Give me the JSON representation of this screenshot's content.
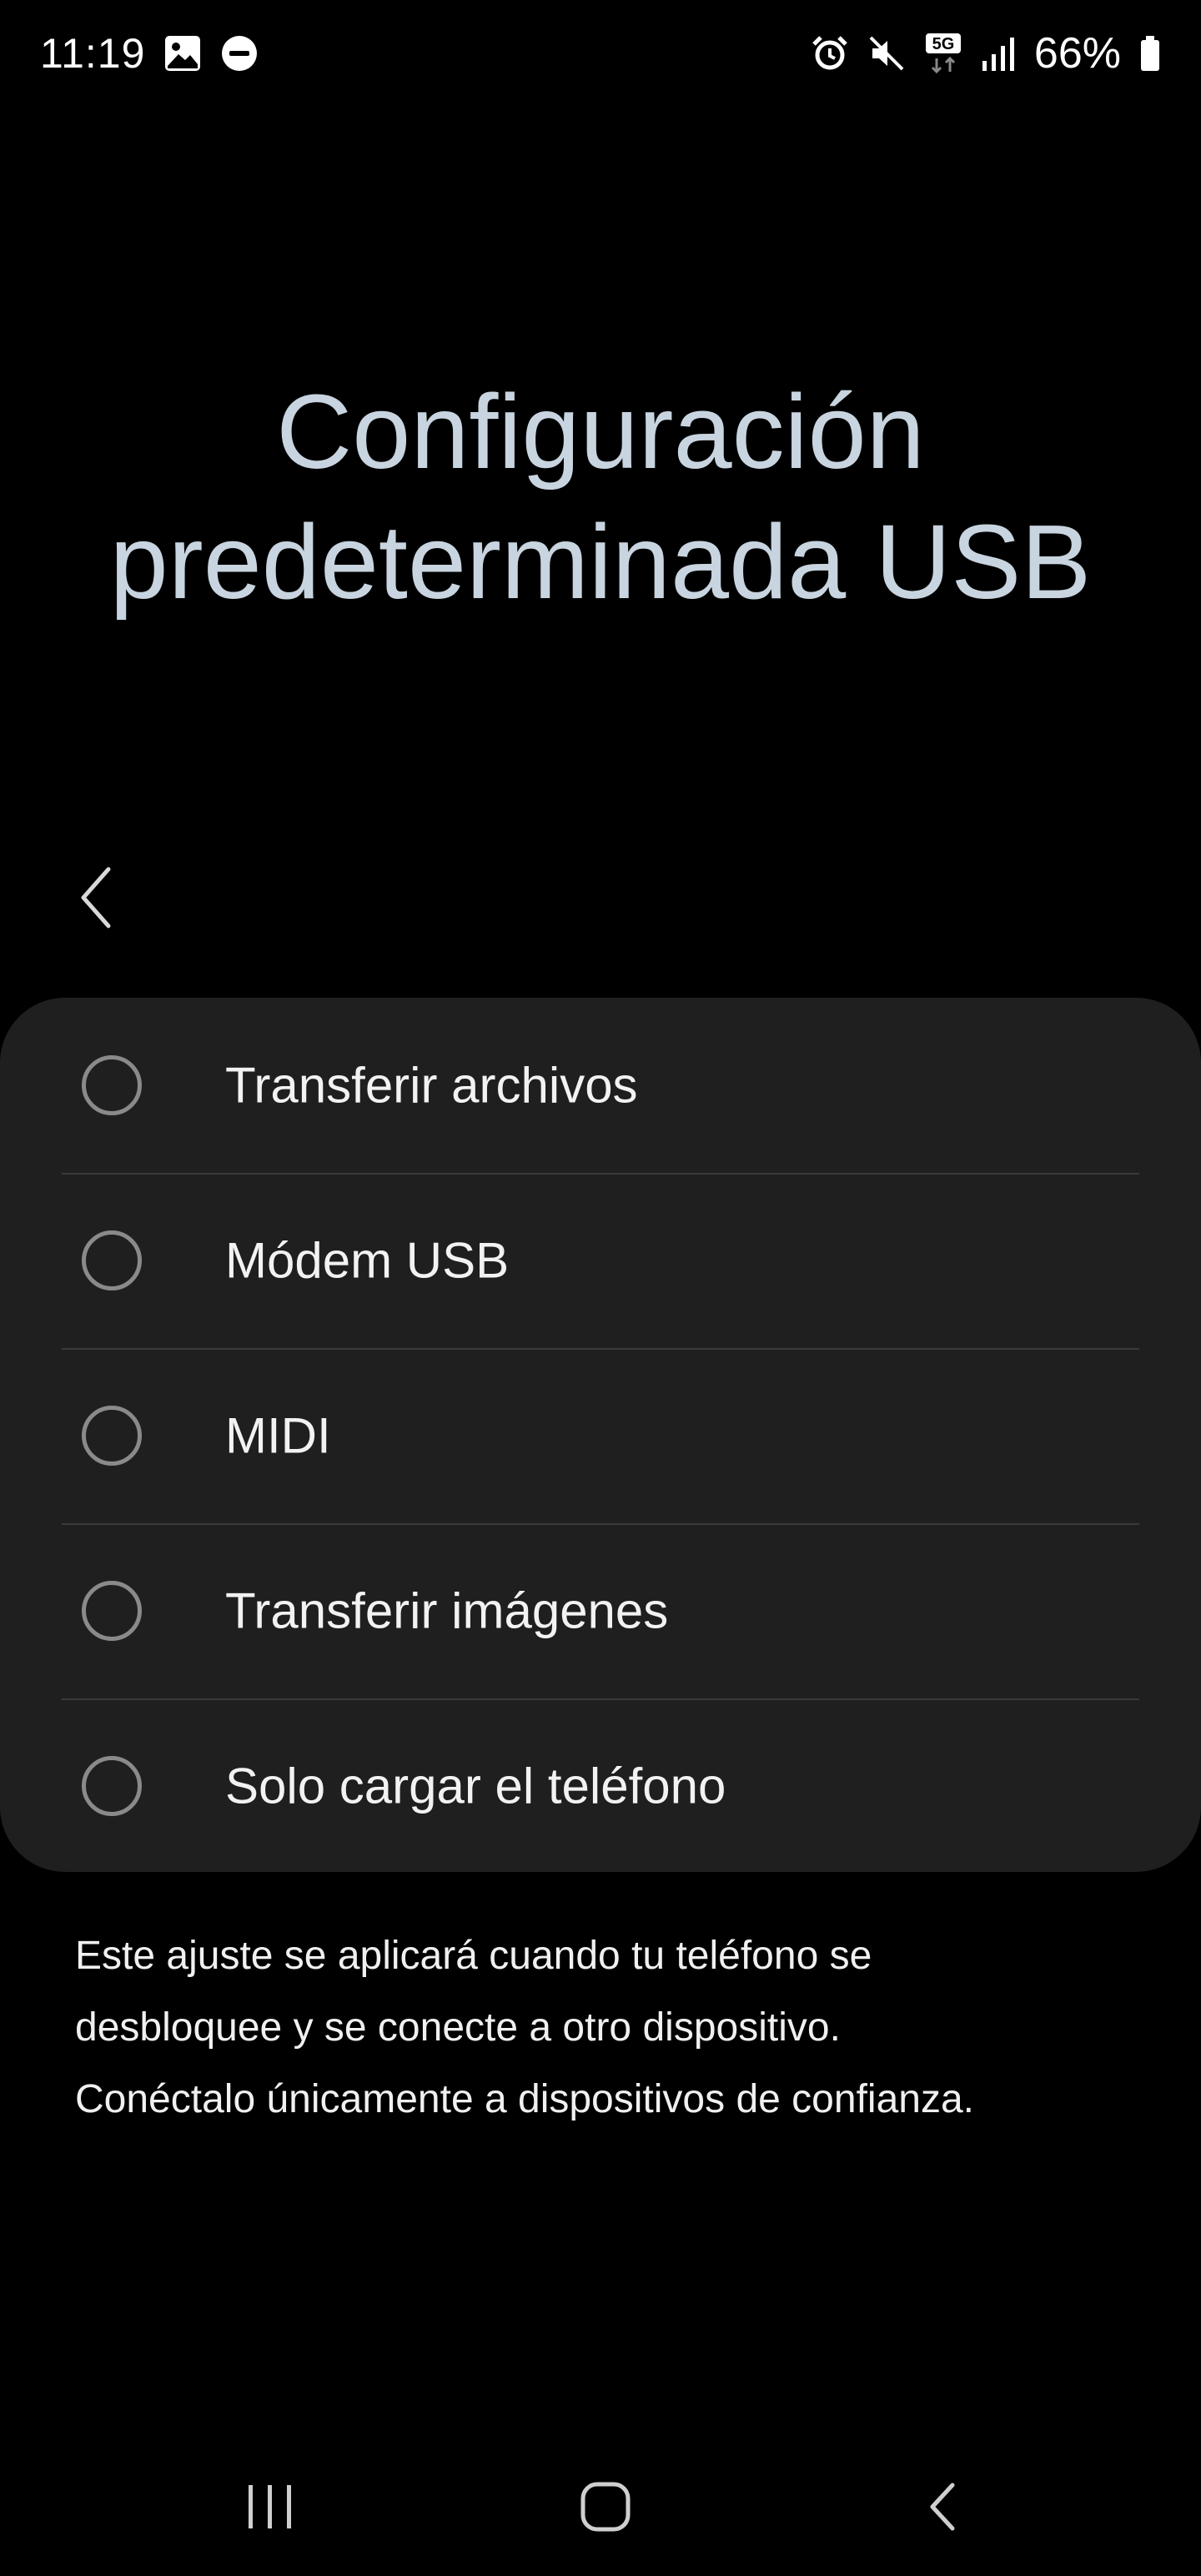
{
  "status_bar": {
    "time": "11:19",
    "battery_percent": "66%",
    "left_icons": [
      "gallery-icon",
      "do-not-disturb-icon"
    ],
    "right_icons": [
      "alarm-icon",
      "mute-icon",
      "5g-icon",
      "signal-icon",
      "battery-icon"
    ]
  },
  "header": {
    "title_line1": "Configuración",
    "title_line2": "predeterminada USB",
    "back_icon": "chevron-left-icon"
  },
  "options": [
    {
      "label": "Transferir archivos",
      "selected": false
    },
    {
      "label": "Módem USB",
      "selected": false
    },
    {
      "label": "MIDI",
      "selected": false
    },
    {
      "label": "Transferir imágenes",
      "selected": false
    },
    {
      "label": "Solo cargar el teléfono",
      "selected": false
    }
  ],
  "info": {
    "line1": "Este ajuste se aplicará cuando tu teléfono se",
    "line2": "desbloquee y se conecte a otro dispositivo.",
    "line3": "Conéctalo únicamente a dispositivos de confianza."
  },
  "nav_bar": {
    "icons": [
      "recent-apps-icon",
      "home-icon",
      "back-icon"
    ]
  },
  "colors": {
    "background": "#000000",
    "card": "#1f1f1f",
    "title": "#c8d4df",
    "radio_border": "#8a8a8a",
    "divider": "#3a3a3a"
  }
}
